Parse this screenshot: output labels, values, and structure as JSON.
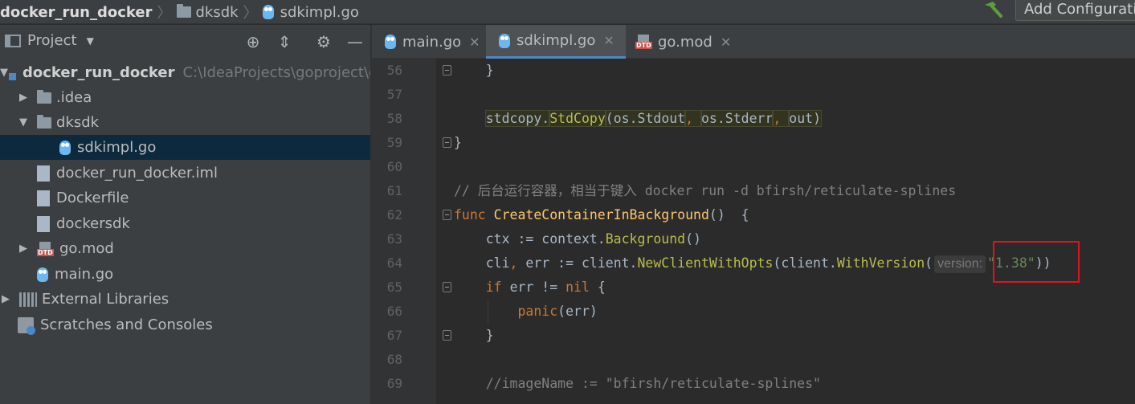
{
  "breadcrumb": {
    "items": [
      {
        "label": "docker_run_docker",
        "icon": "none"
      },
      {
        "label": "dksdk",
        "icon": "folder-icon"
      },
      {
        "label": "sdkimpl.go",
        "icon": "go-file-icon"
      }
    ]
  },
  "toolbar": {
    "build_icon": "hammer-icon",
    "add_config_label": "Add Configurati"
  },
  "project_panel": {
    "title": "Project",
    "tree": [
      {
        "label": "docker_run_docker",
        "path": "C:\\IdeaProjects\\goproject\\d",
        "arrow": "▼",
        "indent": 0,
        "icon": "module-icon",
        "bold": true
      },
      {
        "label": ".idea",
        "arrow": "▶",
        "indent": 1,
        "icon": "folder-icon"
      },
      {
        "label": "dksdk",
        "arrow": "▼",
        "indent": 1,
        "icon": "folder-icon"
      },
      {
        "label": "sdkimpl.go",
        "arrow": "",
        "indent": 2,
        "icon": "go-file-icon",
        "selected": true
      },
      {
        "label": "docker_run_docker.iml",
        "arrow": "",
        "indent": 1,
        "icon": "iml-file-icon"
      },
      {
        "label": "Dockerfile",
        "arrow": "",
        "indent": 1,
        "icon": "dockerfile-icon"
      },
      {
        "label": "dockersdk",
        "arrow": "",
        "indent": 1,
        "icon": "unknown-file-icon"
      },
      {
        "label": "go.mod",
        "arrow": "▶",
        "indent": 1,
        "icon": "dtd-file-icon"
      },
      {
        "label": "main.go",
        "arrow": "",
        "indent": 1,
        "icon": "go-file-icon"
      },
      {
        "label": "External Libraries",
        "arrow": "▶",
        "indent": 0,
        "icon": "library-icon"
      },
      {
        "label": "Scratches and Consoles",
        "arrow": "",
        "indent": 0,
        "icon": "scratch-icon"
      }
    ]
  },
  "tabs": [
    {
      "label": "main.go",
      "icon": "go-file-icon",
      "active": false
    },
    {
      "label": "sdkimpl.go",
      "icon": "go-file-icon",
      "active": true
    },
    {
      "label": "go.mod",
      "icon": "dtd-file-icon",
      "active": false
    }
  ],
  "editor": {
    "lines": [
      {
        "n": "56",
        "fold": true,
        "segs": [
          {
            "t": "    }",
            "c": ""
          }
        ]
      },
      {
        "n": "57",
        "segs": []
      },
      {
        "n": "58",
        "segs": [
          {
            "t": "    ",
            "c": ""
          },
          {
            "t": "stdcopy.",
            "c": "hl"
          },
          {
            "t": "StdCopy",
            "c": "hl call"
          },
          {
            "t": "(os.Stdout",
            "c": "hl"
          },
          {
            "t": ", ",
            "c": "hl kw"
          },
          {
            "t": "os.Stderr",
            "c": "hl"
          },
          {
            "t": ", ",
            "c": "hl kw"
          },
          {
            "t": "out)",
            "c": "hl"
          }
        ]
      },
      {
        "n": "59",
        "fold": true,
        "segs": [
          {
            "t": "}",
            "c": ""
          }
        ]
      },
      {
        "n": "60",
        "segs": []
      },
      {
        "n": "61",
        "segs": [
          {
            "t": "// 后台运行容器，相当于键入 docker run -d bfirsh/reticulate-splines",
            "c": "cmt"
          }
        ]
      },
      {
        "n": "62",
        "fold": true,
        "segs": [
          {
            "t": "func ",
            "c": "kw"
          },
          {
            "t": "CreateContainerInBackground",
            "c": "fn"
          },
          {
            "t": "()  {",
            "c": ""
          }
        ]
      },
      {
        "n": "63",
        "segs": [
          {
            "t": "    ctx := context.",
            "c": ""
          },
          {
            "t": "Background",
            "c": "call"
          },
          {
            "t": "()",
            "c": ""
          }
        ]
      },
      {
        "n": "64",
        "segs": [
          {
            "t": "    cli",
            "c": ""
          },
          {
            "t": ", ",
            "c": "kw"
          },
          {
            "t": "err := client.",
            "c": ""
          },
          {
            "t": "NewClientWithOpts",
            "c": "call"
          },
          {
            "t": "(client.",
            "c": ""
          },
          {
            "t": "WithVersion",
            "c": "call"
          },
          {
            "t": "(",
            "c": ""
          },
          {
            "t": "version:",
            "c": "hint"
          },
          {
            "t": "\"1.38\"",
            "c": "str"
          },
          {
            "t": "))",
            "c": ""
          }
        ]
      },
      {
        "n": "65",
        "fold": true,
        "segs": [
          {
            "t": "    ",
            "c": ""
          },
          {
            "t": "if ",
            "c": "kw"
          },
          {
            "t": "err != ",
            "c": ""
          },
          {
            "t": "nil",
            "c": "kw"
          },
          {
            "t": " {",
            "c": ""
          }
        ]
      },
      {
        "n": "66",
        "guide": true,
        "segs": [
          {
            "t": "        ",
            "c": ""
          },
          {
            "t": "panic",
            "c": "kw"
          },
          {
            "t": "(err)",
            "c": ""
          }
        ]
      },
      {
        "n": "67",
        "fold": true,
        "segs": [
          {
            "t": "    }",
            "c": ""
          }
        ]
      },
      {
        "n": "68",
        "segs": []
      },
      {
        "n": "69",
        "segs": [
          {
            "t": "    //imageName := \"bfirsh/reticulate-splines\"",
            "c": "cmt"
          }
        ]
      }
    ]
  },
  "annotation": {
    "color": "#e0141e"
  }
}
